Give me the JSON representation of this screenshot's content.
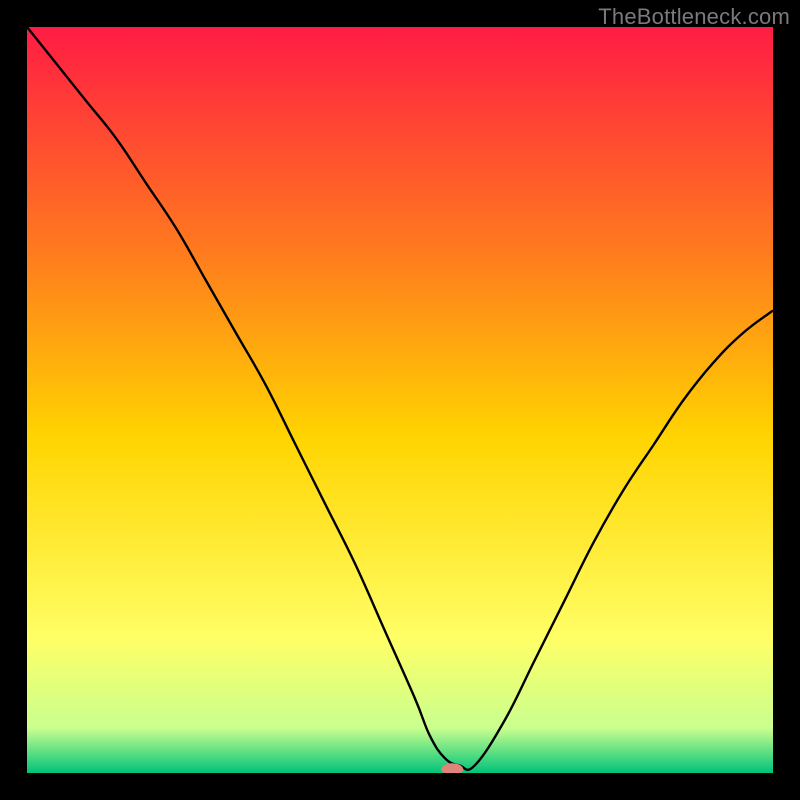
{
  "watermark": "TheBottleneck.com",
  "chart_data": {
    "type": "line",
    "title": "",
    "xlabel": "",
    "ylabel": "",
    "xlim": [
      0,
      100
    ],
    "ylim": [
      0,
      100
    ],
    "gradient_colors": {
      "top": "#ff1c44",
      "upper_mid": "#ff7a1e",
      "mid": "#ffd400",
      "lower_mid": "#ffff66",
      "near_bottom": "#c9ff8e",
      "bottom": "#00c37a"
    },
    "series": [
      {
        "name": "bottleneck-curve",
        "x": [
          0,
          4,
          8,
          12,
          16,
          20,
          24,
          28,
          32,
          36,
          40,
          44,
          48,
          52,
          54,
          56,
          58,
          60,
          64,
          68,
          72,
          76,
          80,
          84,
          88,
          92,
          96,
          100
        ],
        "values": [
          100,
          95,
          90,
          85,
          79,
          73,
          66,
          59,
          52,
          44,
          36,
          28,
          19,
          10,
          5,
          2,
          1,
          1,
          7,
          15,
          23,
          31,
          38,
          44,
          50,
          55,
          59,
          62
        ]
      }
    ],
    "marker": {
      "name": "optimal-point",
      "x": 57,
      "y": 0.5,
      "color": "#e0857c",
      "rx": 11,
      "ry": 6
    }
  }
}
